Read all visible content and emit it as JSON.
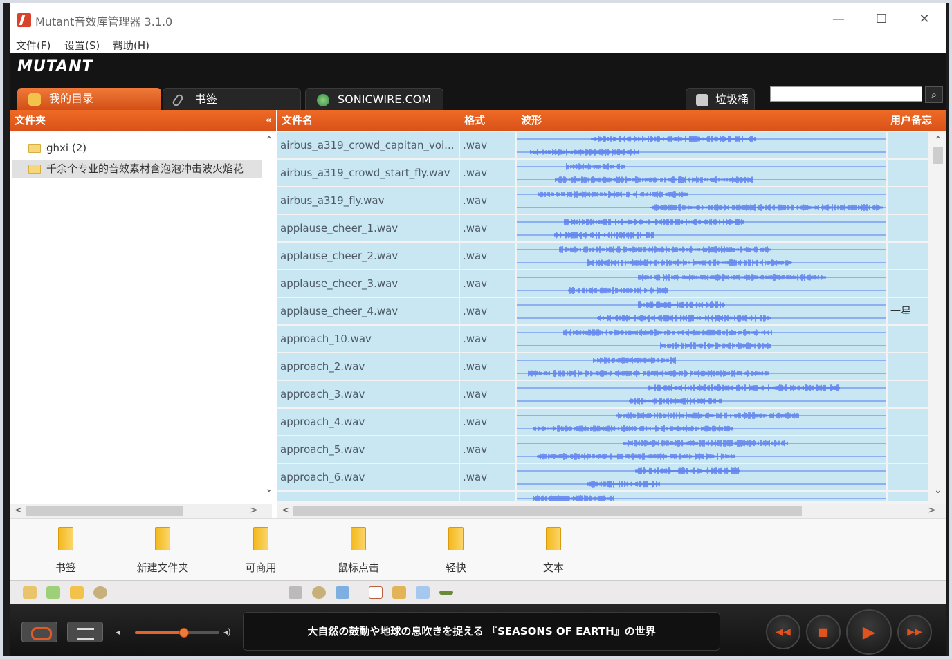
{
  "window": {
    "title": "Mutant音效库管理器 3.1.0",
    "controls": {
      "minimize": "—",
      "maximize": "☐",
      "close": "✕"
    }
  },
  "menu": [
    "文件(F)",
    "设置(S)",
    "帮助(H)"
  ],
  "brand": "MUTANT",
  "tabs": [
    {
      "label": "我的目录",
      "icon": "box-icon"
    },
    {
      "label": "书签",
      "icon": "paperclip-icon"
    },
    {
      "label": "SONICWIRE.COM",
      "icon": "globe-icon"
    }
  ],
  "trash": {
    "label": "垃圾桶"
  },
  "search": {
    "placeholder": "",
    "button": "⌕"
  },
  "folder_panel": {
    "header": "文件夹",
    "collapse": "«",
    "items": [
      {
        "label": "ghxi (2)",
        "selected": false
      },
      {
        "label": "千余个专业的音效素材含泡泡冲击波火焰花",
        "selected": true
      }
    ]
  },
  "file_list": {
    "columns": {
      "name": "文件名",
      "format": "格式",
      "waveform": "波形",
      "memo": "用户备忘"
    },
    "rows": [
      {
        "name": "airbus_a319_crowd_capitan_voi...",
        "format": ".wav",
        "memo": ""
      },
      {
        "name": "airbus_a319_crowd_start_fly.wav",
        "format": ".wav",
        "memo": ""
      },
      {
        "name": "airbus_a319_fly.wav",
        "format": ".wav",
        "memo": ""
      },
      {
        "name": "applause_cheer_1.wav",
        "format": ".wav",
        "memo": ""
      },
      {
        "name": "applause_cheer_2.wav",
        "format": ".wav",
        "memo": ""
      },
      {
        "name": "applause_cheer_3.wav",
        "format": ".wav",
        "memo": ""
      },
      {
        "name": "applause_cheer_4.wav",
        "format": ".wav",
        "memo": "一星"
      },
      {
        "name": "approach_10.wav",
        "format": ".wav",
        "memo": ""
      },
      {
        "name": "approach_2.wav",
        "format": ".wav",
        "memo": ""
      },
      {
        "name": "approach_3.wav",
        "format": ".wav",
        "memo": ""
      },
      {
        "name": "approach_4.wav",
        "format": ".wav",
        "memo": ""
      },
      {
        "name": "approach_5.wav",
        "format": ".wav",
        "memo": ""
      },
      {
        "name": "approach_6.wav",
        "format": ".wav",
        "memo": ""
      },
      {
        "name": "",
        "format": "",
        "memo": ""
      }
    ]
  },
  "bookmarks": [
    "书签",
    "新建文件夹",
    "可商用",
    "鼠标点击",
    "轻快",
    "文本"
  ],
  "player": {
    "now_playing": "大自然の鼓動や地球の息吹きを捉える 『SEASONS OF EARTH』の世界",
    "volume": 0.58
  },
  "colors": {
    "accent": "#e8612a",
    "row": "#c8e7f2",
    "wave": "#5577ee"
  }
}
